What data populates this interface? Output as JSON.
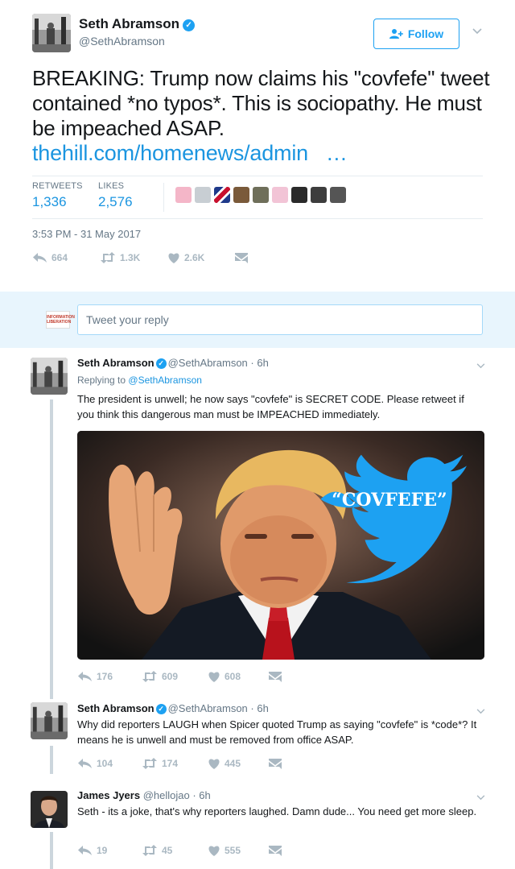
{
  "main_tweet": {
    "name": "Seth Abramson",
    "handle": "@SethAbramson",
    "follow_label": "Follow",
    "text": "BREAKING: Trump now claims his \"covfefe\" tweet contained *no typos*. This is sociopathy.  He must be impeached ASAP.",
    "link": "thehill.com/homenews/admin",
    "link_ellipsis": "…",
    "retweets_label": "RETWEETS",
    "retweets_value": "1,336",
    "likes_label": "LIKES",
    "likes_value": "2,576",
    "timestamp": "3:53 PM - 31 May 2017",
    "reply_count": "664",
    "retweet_count": "1.3K",
    "like_count": "2.6K"
  },
  "reply_box": {
    "placeholder": "Tweet your reply",
    "avatar_text": "INFORMATION LIBERATION"
  },
  "replies": [
    {
      "name": "Seth Abramson",
      "handle": "@SethAbramson",
      "time": "· 6h",
      "replying_prefix": "Replying to",
      "replying_to": "@SethAbramson",
      "text": "The president is unwell; he now says \"covfefe\" is SECRET CODE. Please retweet if you think this dangerous man must be IMPEACHED immediately.",
      "media_caption": "“COVFEFE”",
      "reply_count": "176",
      "retweet_count": "609",
      "like_count": "608"
    },
    {
      "name": "Seth Abramson",
      "handle": "@SethAbramson",
      "time": "· 6h",
      "text": "Why did reporters LAUGH when Spicer quoted Trump as saying \"covfefe\" is *code*? It means he is unwell and must be removed from office ASAP.",
      "reply_count": "104",
      "retweet_count": "174",
      "like_count": "445"
    },
    {
      "name": "James Jyers",
      "handle": "@hellojao",
      "time": "· 6h",
      "text": "Seth - its a joke, that's why reporters laughed.  Damn dude... You need get more sleep.",
      "reply_count": "19",
      "retweet_count": "45",
      "like_count": "555"
    }
  ],
  "colors": {
    "twitter_blue": "#1da1f2",
    "link_blue": "#1b95e0",
    "muted_gray": "#657786",
    "icon_gray": "#aab8c2",
    "reply_bg": "#e8f5fd"
  }
}
